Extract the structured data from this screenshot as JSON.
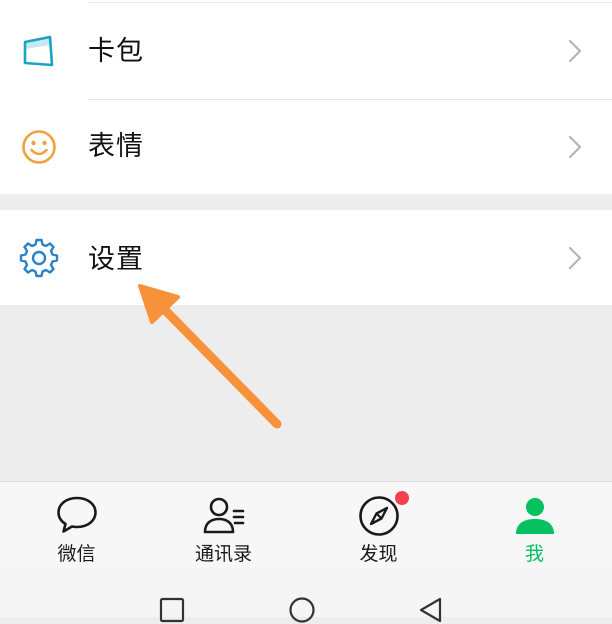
{
  "menu": {
    "items": [
      {
        "label": "卡包",
        "icon": "card-wallet-icon"
      },
      {
        "label": "表情",
        "icon": "smiley-icon"
      },
      {
        "label": "设置",
        "icon": "gear-icon"
      }
    ]
  },
  "tabbar": {
    "tabs": [
      {
        "label": "微信",
        "icon": "chat-bubble-icon",
        "active": false
      },
      {
        "label": "通讯录",
        "icon": "contacts-icon",
        "active": false
      },
      {
        "label": "发现",
        "icon": "compass-icon",
        "active": false,
        "badge": true
      },
      {
        "label": "我",
        "icon": "person-icon",
        "active": true
      }
    ]
  },
  "nav": {
    "buttons": [
      "recent-apps-icon",
      "home-icon",
      "back-icon"
    ]
  },
  "colors": {
    "accent_green": "#07c160",
    "badge_red": "#f0424f",
    "annotation_orange": "#f7923b",
    "card_icon": "#1aa3c4",
    "smiley_icon": "#f0a13c",
    "gear_icon": "#2a82c9",
    "page_bg": "#ededed"
  }
}
